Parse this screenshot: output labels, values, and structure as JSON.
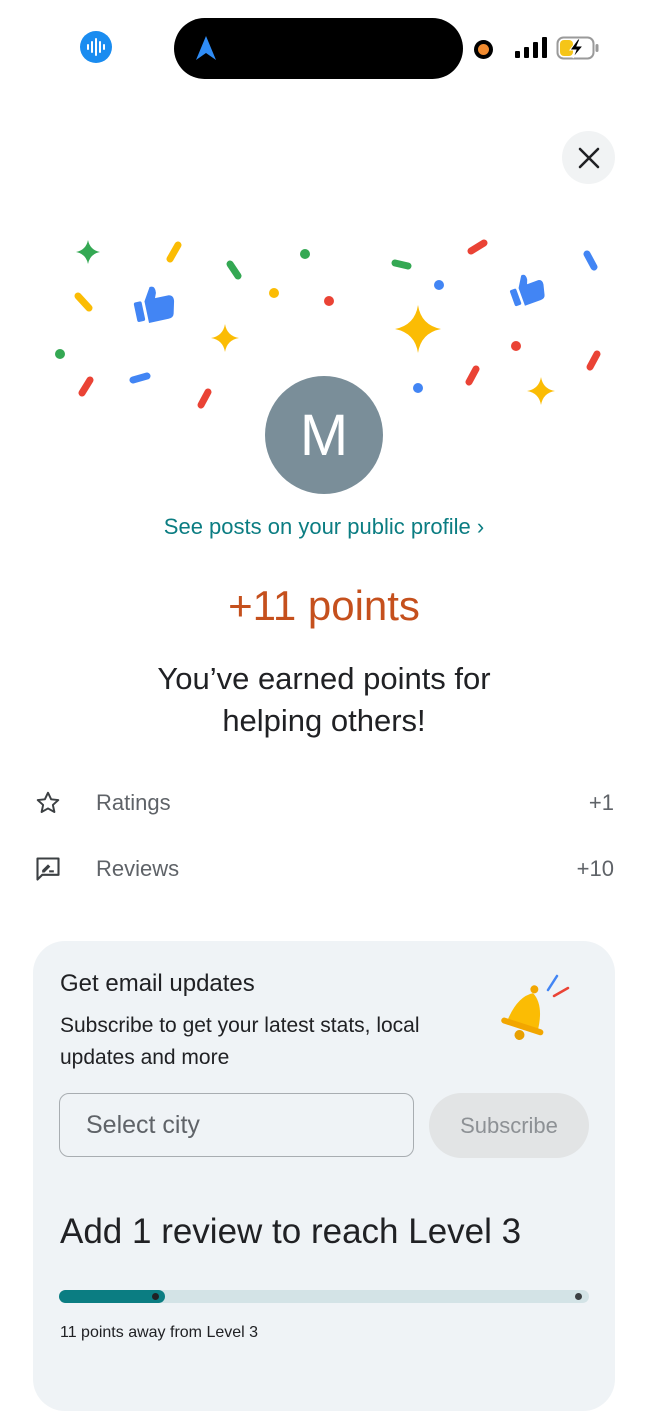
{
  "status_bar": {
    "island_icon": "navigation-arrow-icon",
    "left_icon": "audio-wave-icon"
  },
  "header": {
    "close_icon": "close-icon"
  },
  "profile": {
    "avatar_letter": "M",
    "link_text": "See posts on your public profile ›"
  },
  "reward": {
    "points": "+11 points",
    "message": "You’ve earned points for helping others!"
  },
  "breakdown": [
    {
      "label": "Ratings",
      "value": "+1",
      "icon": "star-icon"
    },
    {
      "label": "Reviews",
      "value": "+10",
      "icon": "review-edit-icon"
    }
  ],
  "email_card": {
    "title": "Get email updates",
    "subtitle": "Subscribe to get your latest stats, local updates and more",
    "city_placeholder": "Select city",
    "subscribe_label": "Subscribe",
    "icon": "bell-icon"
  },
  "level": {
    "title": "Add 1 review to reach Level 3",
    "progress_fraction": 0.2,
    "away_text": "11 points away from Level 3"
  },
  "colors": {
    "accent_teal": "#0b7d82",
    "points_orange": "#c5501d",
    "card_bg": "#eff3f6",
    "avatar_bg": "#7a8e99"
  }
}
